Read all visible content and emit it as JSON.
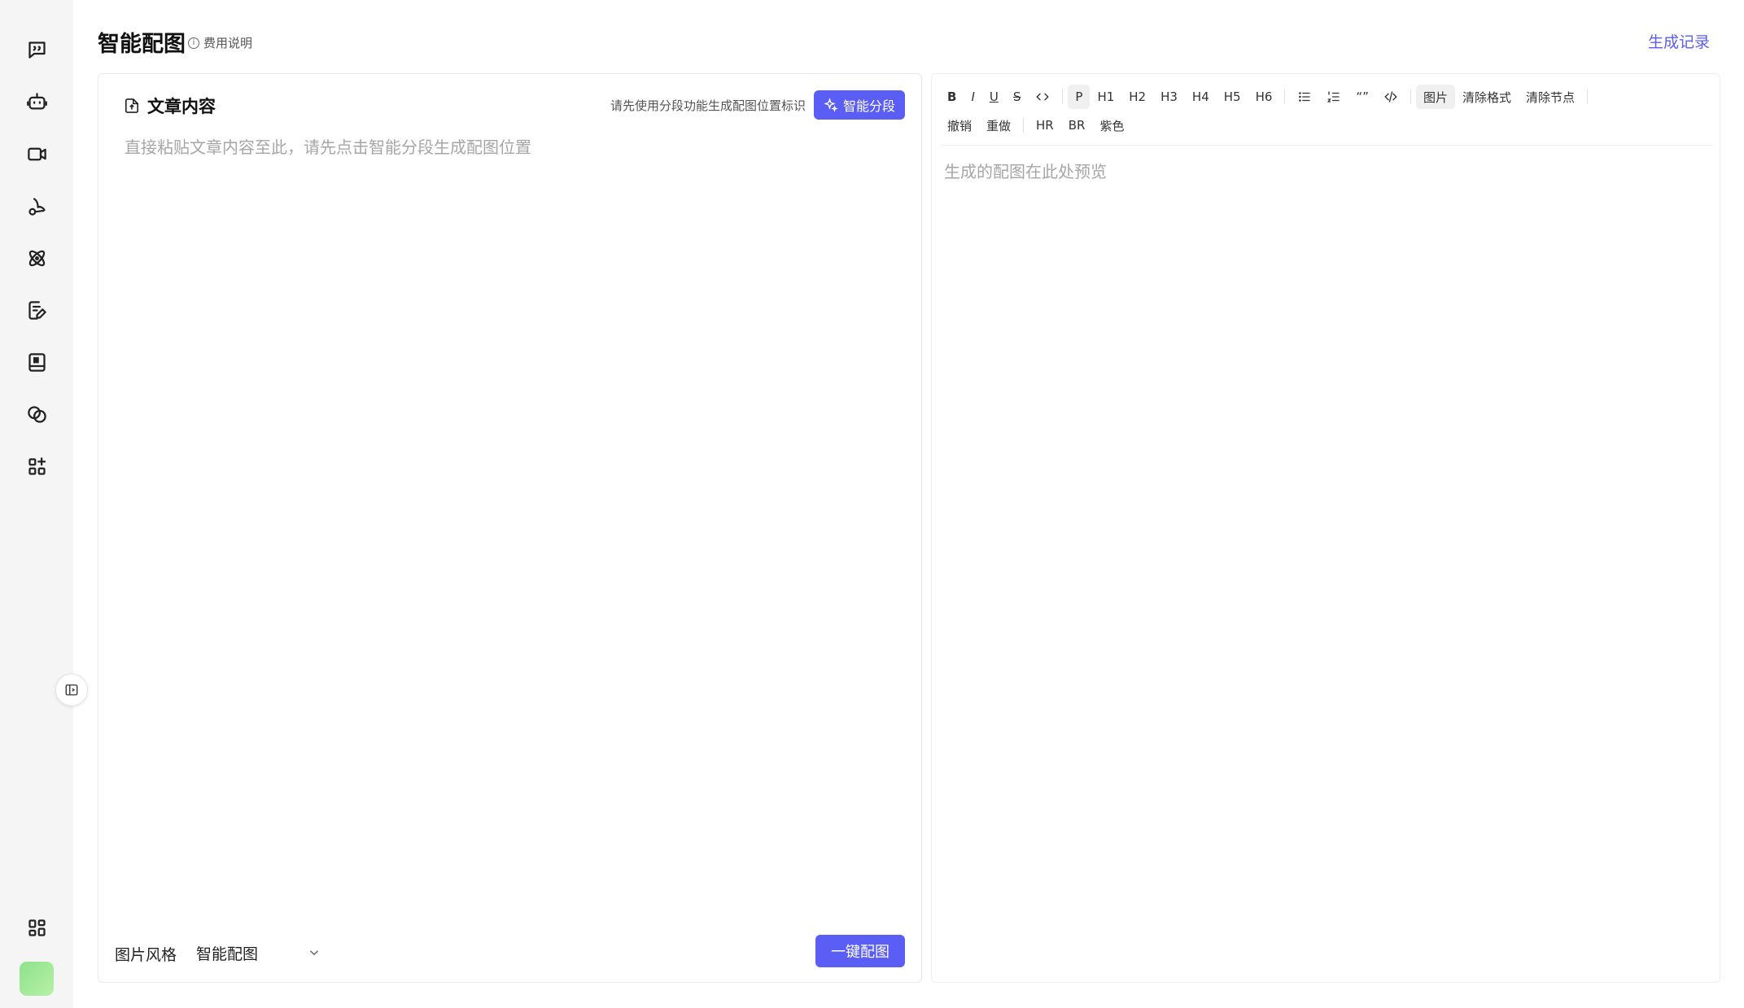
{
  "header": {
    "title": "智能配图",
    "fee_info": "费用说明",
    "history_link": "生成记录"
  },
  "sidebar": {
    "icons": [
      "chat-icon",
      "robot-icon",
      "video-icon",
      "music-icon",
      "atom-icon",
      "edit-document-icon",
      "book-icon",
      "link-icon",
      "apps-add-icon"
    ],
    "bottom_icon": "grid-icon",
    "avatar": "user-avatar"
  },
  "editor_panel": {
    "title": "文章内容",
    "hint": "请先使用分段功能生成配图位置标识",
    "smart_segment_button": "智能分段",
    "placeholder": "直接粘贴文章内容至此，请先点击智能分段生成配图位置",
    "style_label": "图片风格",
    "style_value": "智能配图",
    "generate_button": "一键配图"
  },
  "preview_panel": {
    "toolbar_row1": {
      "bold": "B",
      "italic": "I",
      "underline": "U",
      "strike": "S",
      "p": "P",
      "h1": "H1",
      "h2": "H2",
      "h3": "H3",
      "h4": "H4",
      "h5": "H5",
      "h6": "H6",
      "quote": "“”",
      "image": "图片",
      "clear_format": "清除格式",
      "clear_node": "清除节点"
    },
    "toolbar_row2": {
      "undo": "撤销",
      "redo": "重做",
      "hr": "HR",
      "br": "BR",
      "purple": "紫色"
    },
    "placeholder": "生成的配图在此处预览"
  },
  "colors": {
    "accent": "#5b5ef4",
    "sidebar_bg": "#f5f5f5"
  }
}
